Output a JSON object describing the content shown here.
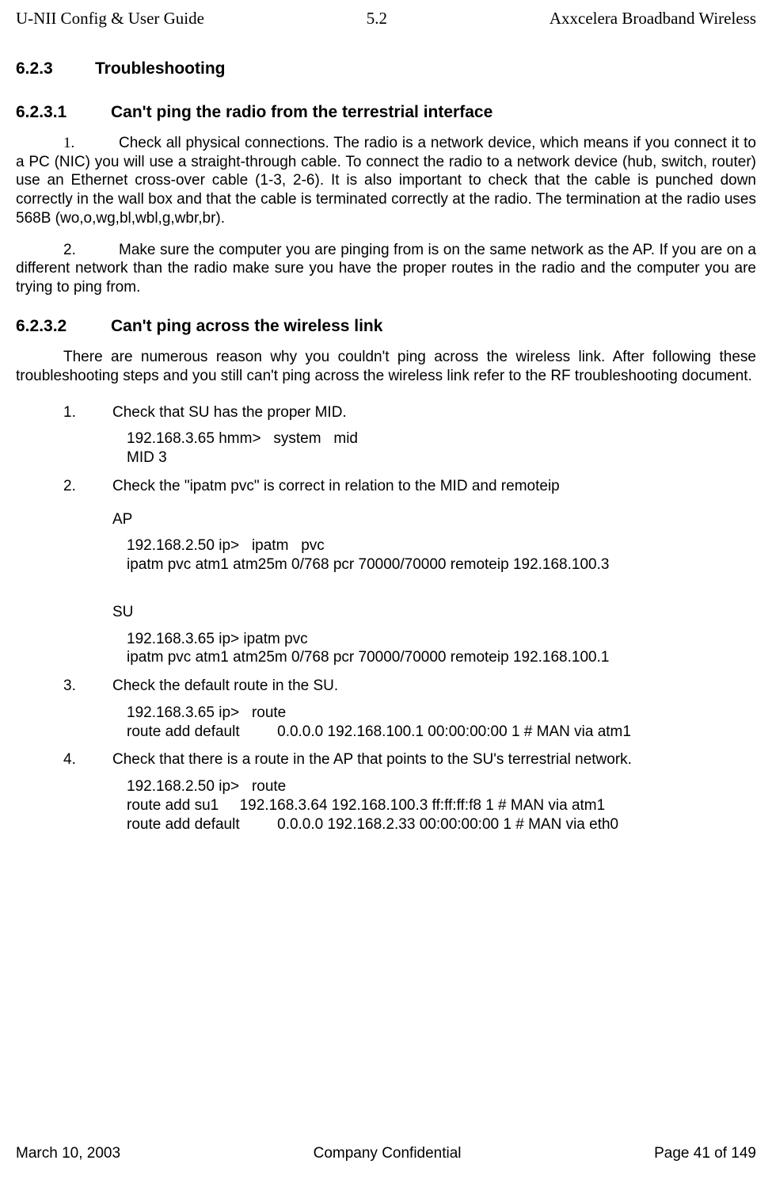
{
  "header": {
    "left": "U-NII Config & User Guide",
    "center": "5.2",
    "right": "Axxcelera Broadband Wireless"
  },
  "sec623": {
    "num": "6.2.3",
    "title": "Troubleshooting"
  },
  "sec6231": {
    "num": "6.2.3.1",
    "title": "Can't ping the radio from the terrestrial interface",
    "p1num": "1.",
    "p1": "Check all physical connections.  The radio is a network device, which means if you connect it to a PC (NIC) you will use a straight-through cable.  To connect the radio to a network device (hub, switch, router) use an Ethernet cross-over cable (1-3, 2-6).  It is also important to check that the cable is punched down correctly in the wall box and that the cable is terminated correctly at the radio.  The termination at the radio uses 568B (wo,o,wg,bl,wbl,g,wbr,br).",
    "p2num": "2.",
    "p2": "Make sure the computer you are pinging from is on the same network as the AP. If you are on a different network than the radio make sure you have the proper routes in the radio and the computer you are trying to ping from."
  },
  "sec6232": {
    "num": "6.2.3.2",
    "title": "Can't ping across the wireless link",
    "intro": "There are numerous reason why you couldn't ping across the wireless link. After following these troubleshooting steps and you still can't ping across the wireless link refer to the RF troubleshooting document.",
    "items": {
      "n1": "1.",
      "t1": "Check that SU has the proper MID.",
      "c1": "192.168.3.65 hmm>   system   mid\nMID 3",
      "n2": "2.",
      "t2": "Check the \"ipatm pvc\" is correct in relation to the MID and remoteip",
      "apLabel": "AP",
      "c2a": "192.168.2.50 ip>   ipatm   pvc\nipatm pvc atm1 atm25m 0/768 pcr 70000/70000 remoteip 192.168.100.3",
      "suLabel": "SU",
      "c2b": "192.168.3.65 ip> ipatm pvc\nipatm pvc atm1 atm25m 0/768 pcr 70000/70000 remoteip 192.168.100.1",
      "n3": "3.",
      "t3": "Check the default route in the SU.",
      "c3": "192.168.3.65 ip>   route\nroute add default         0.0.0.0 192.168.100.1 00:00:00:00 1 # MAN via atm1",
      "n4": "4.",
      "t4": "Check that there is a route in the AP that points to the SU's terrestrial network.",
      "c4": "192.168.2.50 ip>   route\nroute add su1     192.168.3.64 192.168.100.3 ff:ff:ff:f8 1 # MAN via atm1\nroute add default         0.0.0.0 192.168.2.33 00:00:00:00 1 # MAN via eth0"
    }
  },
  "footer": {
    "left": "March 10, 2003",
    "center": "Company Confidential",
    "right": "Page 41 of 149"
  }
}
